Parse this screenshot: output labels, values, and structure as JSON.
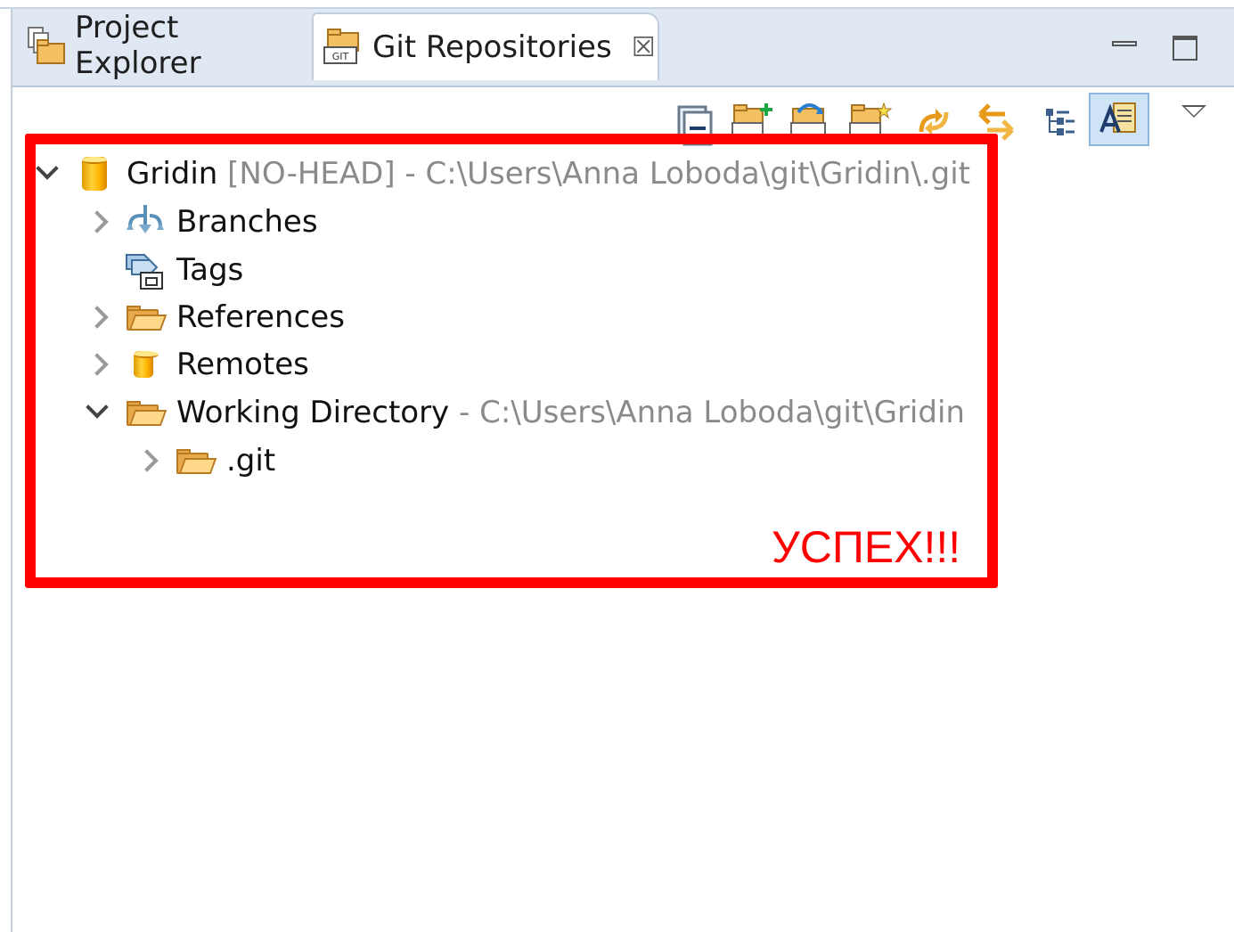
{
  "tabs": {
    "project_explorer": "Project Explorer",
    "git_repositories": "Git Repositories",
    "close_glyph": "☒",
    "git_badge": "GIT"
  },
  "tree": {
    "repo": {
      "name": "Gridin",
      "state": "[NO-HEAD]",
      "path": "- C:\\Users\\Anna Loboda\\git\\Gridin\\.git"
    },
    "branches": "Branches",
    "tags": "Tags",
    "references": "References",
    "remotes": "Remotes",
    "working_directory": {
      "label": "Working Directory",
      "path": "- C:\\Users\\Anna Loboda\\git\\Gridin"
    },
    "git_folder": ".git"
  },
  "annotation": {
    "text": "УСПЕХ!!!",
    "color": "#ff0000"
  },
  "icons": [
    "collapse-all-icon",
    "add-repository-icon",
    "clone-repository-icon",
    "create-repository-icon",
    "refresh-icon",
    "link-with-selection-icon",
    "hierarchical-layout-icon",
    "show-labels-icon",
    "view-menu-icon"
  ]
}
